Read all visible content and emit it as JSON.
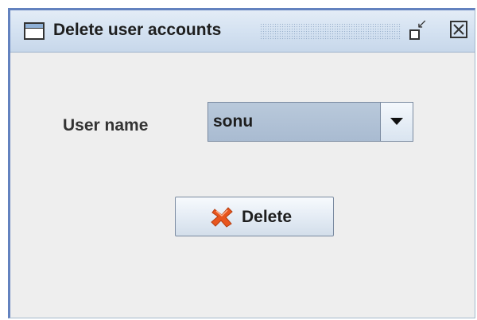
{
  "window": {
    "title": "Delete user accounts",
    "icon": "window-icon",
    "controls": [
      "restore-icon",
      "close-icon"
    ]
  },
  "form": {
    "user_label": "User name",
    "user_select": {
      "value": "sonu",
      "icon": "chevron-down-icon"
    },
    "delete_button": {
      "label": "Delete",
      "icon": "red-x-icon"
    }
  },
  "colors": {
    "titlebar": "#d3e1f1",
    "border": "#6382bf",
    "background": "#eeeeee",
    "combo": "#b0c2d8",
    "delete_icon": "#e8561e"
  }
}
